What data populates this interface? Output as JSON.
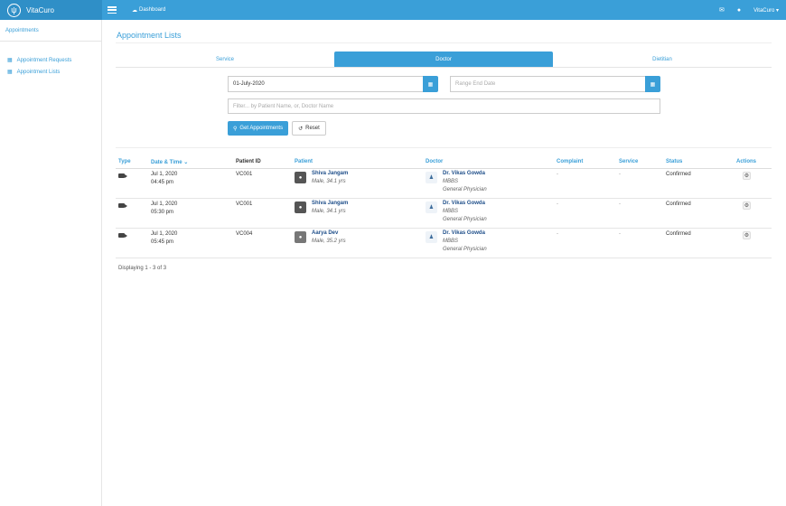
{
  "topbar": {
    "brand": "VitaCuro",
    "dashboard_label": "Dashboard",
    "user_label": "VitaCuro"
  },
  "sidebar": {
    "heading": "Appointments",
    "items": [
      {
        "label": "Appointment Requests",
        "icon": "calendar-icon"
      },
      {
        "label": "Appointment Lists",
        "icon": "calendar-icon"
      }
    ]
  },
  "main": {
    "title": "Appointment Lists",
    "tabs": [
      {
        "label": "Service",
        "active": false
      },
      {
        "label": "Doctor",
        "active": true
      },
      {
        "label": "Dietitian",
        "active": false
      }
    ],
    "start_date_value": "01-July-2020",
    "end_date_placeholder": "Range End Date",
    "filter_placeholder": "Filter... by Patient Name, or, Doctor Name",
    "get_button": "Get Appointments",
    "reset_button": "Reset"
  },
  "table": {
    "headers": {
      "type": "Type",
      "date": "Date & Time",
      "pid": "Patient ID",
      "patient": "Patient",
      "doctor": "Doctor",
      "complaint": "Complaint",
      "service": "Service",
      "status": "Status",
      "actions": "Actions"
    },
    "rows": [
      {
        "date": "Jul 1, 2020",
        "time": "04:45 pm",
        "pid": "VC001",
        "patient_name": "Shiva Jangam",
        "patient_info": "Male, 34.1 yrs",
        "doctor_name": "Dr. Vikas Gowda",
        "doctor_degree": "MBBS",
        "doctor_spec": "General Physician",
        "complaint": "-",
        "service": "-",
        "status": "Confirmed"
      },
      {
        "date": "Jul 1, 2020",
        "time": "05:30 pm",
        "pid": "VC001",
        "patient_name": "Shiva Jangam",
        "patient_info": "Male, 34.1 yrs",
        "doctor_name": "Dr. Vikas Gowda",
        "doctor_degree": "MBBS",
        "doctor_spec": "General Physician",
        "complaint": "-",
        "service": "-",
        "status": "Confirmed"
      },
      {
        "date": "Jul 1, 2020",
        "time": "05:45 pm",
        "pid": "VC004",
        "patient_name": "Aarya Dev",
        "patient_info": "Male, 35.2 yrs",
        "doctor_name": "Dr. Vikas Gowda",
        "doctor_degree": "MBBS",
        "doctor_spec": "General Physician",
        "complaint": "-",
        "service": "-",
        "status": "Confirmed"
      }
    ],
    "footer": "Displaying 1 - 3 of 3"
  },
  "colors": {
    "accent": "#3a9fd8",
    "brand_dark": "#2f8fc7",
    "name_link": "#1f4f8a"
  }
}
